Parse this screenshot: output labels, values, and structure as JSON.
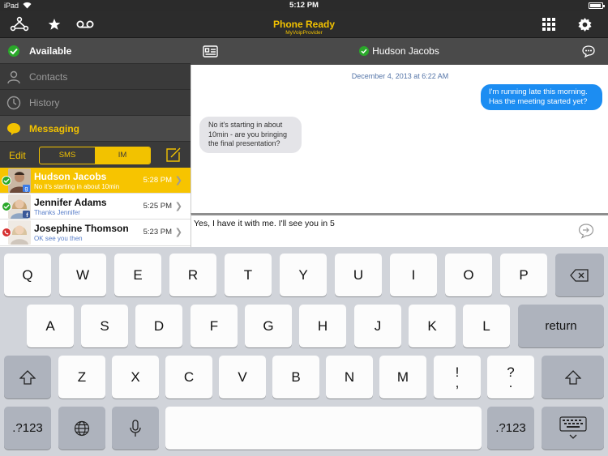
{
  "status_bar": {
    "carrier": "iPad",
    "time": "5:12 PM"
  },
  "toolbar": {
    "title": "Phone Ready",
    "subtitle": "MyVoipProvider"
  },
  "sidebar": {
    "menu": [
      {
        "label": "Available",
        "icon": "check-circle-icon"
      },
      {
        "label": "Contacts",
        "icon": "person-icon"
      },
      {
        "label": "History",
        "icon": "clock-icon"
      },
      {
        "label": "Messaging",
        "icon": "chat-bubble-icon"
      }
    ],
    "edit_label": "Edit",
    "segments": {
      "sms": "SMS",
      "im": "IM",
      "selected": "IM"
    },
    "conversations": [
      {
        "name": "Hudson Jacobs",
        "preview": "No it's starting in about 10min",
        "time": "5:28 PM",
        "status": "available",
        "selected": true,
        "network": "google"
      },
      {
        "name": "Jennifer Adams",
        "preview": "Thanks Jennifer",
        "time": "5:25 PM",
        "status": "available",
        "selected": false,
        "network": "facebook"
      },
      {
        "name": "Josephine Thomson",
        "preview": "OK see you then",
        "time": "5:23 PM",
        "status": "on-call",
        "selected": false,
        "network": ""
      }
    ]
  },
  "chat": {
    "contact": "Hudson Jacobs",
    "date": "December 4, 2013 at 6:22 AM",
    "messages": [
      {
        "direction": "outgoing",
        "text": "I'm running late this morning. Has the meeting started yet?"
      },
      {
        "direction": "incoming",
        "text": "No it's starting in about 10min - are you bringing the final presentation?"
      }
    ],
    "input_text": "Yes, I have it with me. I'll see you in 5"
  },
  "keyboard": {
    "row1": [
      "Q",
      "W",
      "E",
      "R",
      "T",
      "Y",
      "U",
      "I",
      "O",
      "P"
    ],
    "row2": [
      "A",
      "S",
      "D",
      "F",
      "G",
      "H",
      "J",
      "K",
      "L"
    ],
    "row3": [
      "Z",
      "X",
      "C",
      "V",
      "B",
      "N",
      "M"
    ],
    "return_label": "return",
    "numbers_label": ".?123",
    "punct": [
      {
        "top": "!",
        "bottom": ","
      },
      {
        "top": "?",
        "bottom": "."
      }
    ]
  },
  "colors": {
    "accent": "#f2c200",
    "bubble_out": "#1c8df2",
    "status_ok": "#2aa82a"
  }
}
